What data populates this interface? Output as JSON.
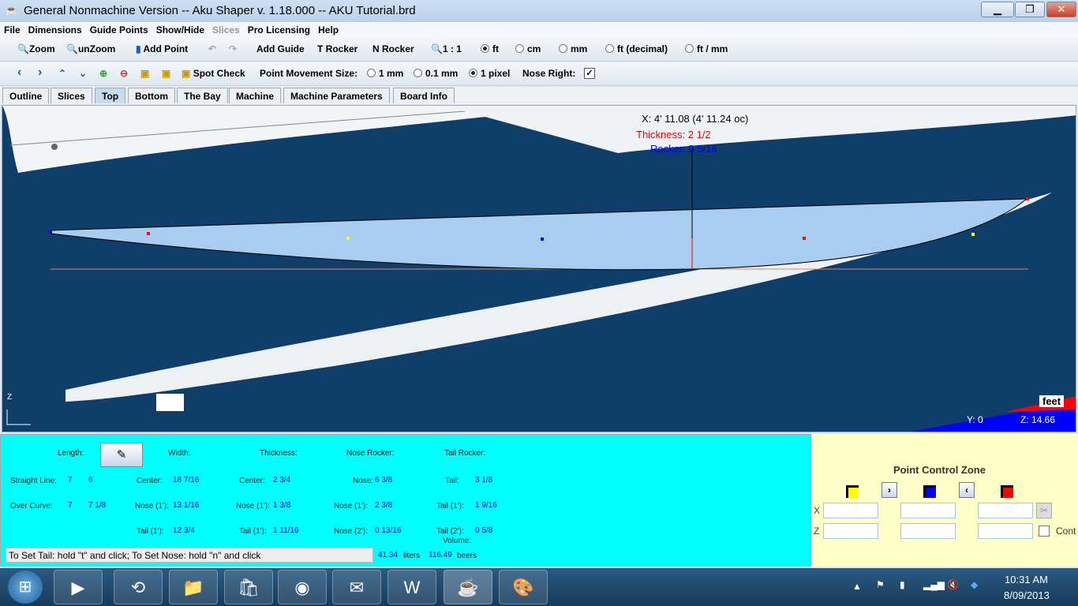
{
  "window": {
    "title": "General Nonmachine Version -- Aku Shaper v. 1.18.000  --  AKU Tutorial.brd",
    "minimize": "▁",
    "restore": "❐",
    "close": "✕"
  },
  "menu": [
    "File",
    "Dimensions",
    "Guide Points",
    "Show/Hide",
    "Slices",
    "Pro Licensing",
    "Help"
  ],
  "toolbar1": {
    "zoom": "Zoom",
    "unzoom": "unZoom",
    "add_point": "Add Point",
    "add_guide": "Add Guide",
    "t_rocker": "T Rocker",
    "n_rocker": "N Rocker",
    "scale": "1 : 1",
    "units": [
      {
        "label": "ft",
        "selected": true
      },
      {
        "label": "cm",
        "selected": false
      },
      {
        "label": "mm",
        "selected": false
      },
      {
        "label": "ft (decimal)",
        "selected": false
      },
      {
        "label": "ft / mm",
        "selected": false
      }
    ]
  },
  "toolbar2": {
    "spot_check": "Spot Check",
    "pms_label": "Point Movement Size:",
    "pms": [
      {
        "label": "1 mm",
        "selected": false
      },
      {
        "label": "0.1 mm",
        "selected": false
      },
      {
        "label": "1 pixel",
        "selected": true
      }
    ],
    "nose_right": "Nose Right:",
    "nose_right_checked": true,
    "checkmark": "✓"
  },
  "tabs": [
    {
      "label": "Outline"
    },
    {
      "label": "Slices"
    },
    {
      "label": "Top",
      "active": true
    },
    {
      "label": "Bottom"
    },
    {
      "label": "The Bay"
    },
    {
      "label": "Machine"
    },
    {
      "label": "Machine Parameters"
    },
    {
      "label": "Board Info"
    }
  ],
  "canvas": {
    "x_readout": "X: 4' 11.08 (4' 11.24 oc)",
    "thickness": "Thickness: 2 1/2",
    "rocker": "Rocker: 0 5/16",
    "units_label": "feet",
    "y": "Y: 0",
    "z": "Z: 14.66",
    "axis_z": "Z",
    "colors": {
      "thickness": "#ff0000",
      "rocker": "#0000ff",
      "board": "#a8cdf0"
    }
  },
  "info": {
    "length": "Length:",
    "width": "Width:",
    "thickness": "Thickness:",
    "nose_rocker": "Nose Rocker:",
    "tail_rocker": "Tail Rocker:",
    "straight_line": "Straight Line:",
    "sl_ft": "7",
    "sl_in": "6",
    "over_curve": "Over Curve:",
    "oc_ft": "7",
    "oc_in": "7 1/8",
    "w_center": "Center:",
    "w_center_v": "18 7/16",
    "w_nose": "Nose (1'):",
    "w_nose_v": "13 1/16",
    "w_tail": "Tail (1'):",
    "w_tail_v": "12 3/4",
    "t_center": "Center:",
    "t_center_v": "2 3/4",
    "t_nose": "Nose (1'):",
    "t_nose_v": "1 3/8",
    "t_tail": "Tail (1'):",
    "t_tail_v": "1 11/16",
    "n_nose": "Nose:",
    "n_nose_v": "6 3/8",
    "n_nose1": "Nose (1'):",
    "n_nose1_v": "2 3/8",
    "n_nose2": "Nose (2'):",
    "n_nose2_v": "0 13/16",
    "tr_tail": "Tail:",
    "tr_tail_v": "3 1/8",
    "tr_tail1": "Tail (1'):",
    "tr_tail1_v": "1 9/16",
    "tr_tail2": "Tail (2'):",
    "tr_tail2_v": "0 5/8",
    "volume": "Volume:",
    "liters_v": "41.34",
    "liters": "liters",
    "beers_v": "116.49",
    "beers": "beers",
    "status": "To Set Tail: hold \"t\" and click; To Set Nose: hold \"n\" and click"
  },
  "pcz": {
    "title": "Point Control Zone",
    "x": "X",
    "z": "Z",
    "cont": "Cont",
    "colors": [
      "#ffff00",
      "#0000ff",
      "#ff0000"
    ]
  },
  "taskbar": {
    "time": "10:31 AM",
    "date": "8/09/2013"
  }
}
